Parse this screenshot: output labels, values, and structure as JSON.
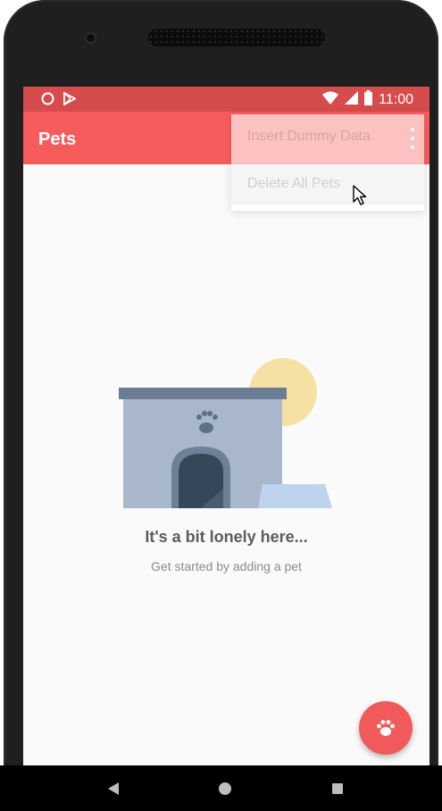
{
  "status_bar": {
    "time": "11:00",
    "icons": [
      "notification-circle-icon",
      "play-store-icon",
      "wifi-icon",
      "signal-icon",
      "battery-icon"
    ]
  },
  "app_bar": {
    "title": "Pets",
    "overflow_icon": "more-vert-icon",
    "background_color": "#f75c5c"
  },
  "overflow_menu": {
    "items": [
      {
        "label": "Insert Dummy Data"
      },
      {
        "label": "Delete All Pets"
      }
    ]
  },
  "empty_state": {
    "illustration": "pet-house-illustration",
    "title": "It's a bit lonely here...",
    "subtitle": "Get started by adding a pet"
  },
  "fab": {
    "icon": "paw-icon",
    "color": "#f15a5a"
  },
  "nav_bar": {
    "icons": [
      "back-icon",
      "home-icon",
      "recents-icon"
    ]
  }
}
